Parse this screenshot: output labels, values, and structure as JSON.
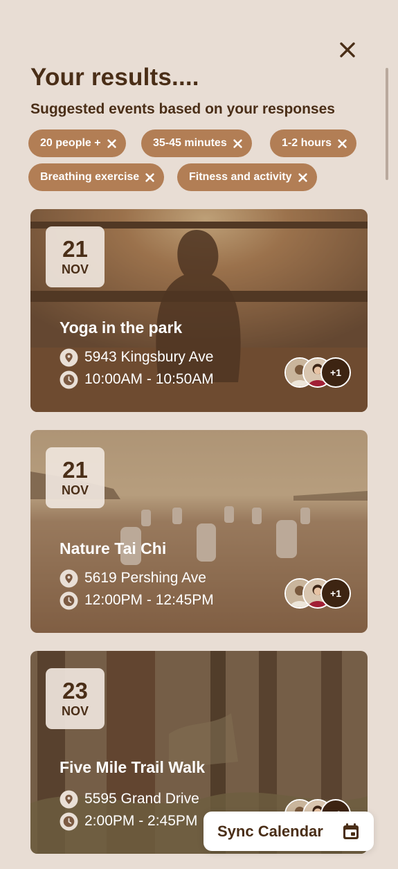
{
  "header": {
    "title": "Your results....",
    "subtitle": "Suggested events based on your responses"
  },
  "filters": [
    {
      "label": "20 people +"
    },
    {
      "label": "35-45 minutes"
    },
    {
      "label": "1-2 hours"
    },
    {
      "label": "Breathing exercise"
    },
    {
      "label": "Fitness and activity"
    }
  ],
  "events": [
    {
      "day": "21",
      "month": "NOV",
      "title": "Yoga in the park",
      "address": "5943 Kingsbury Ave",
      "time": "10:00AM - 10:50AM",
      "more": "+1"
    },
    {
      "day": "21",
      "month": "NOV",
      "title": "Nature Tai Chi",
      "address": "5619 Pershing Ave",
      "time": "12:00PM - 12:45PM",
      "more": "+1"
    },
    {
      "day": "23",
      "month": "NOV",
      "title": "Five Mile Trail Walk",
      "address": "5595 Grand Drive",
      "time": "2:00PM - 2:45PM",
      "more": "+1"
    }
  ],
  "sync": {
    "label": "Sync Calendar"
  },
  "colors": {
    "background": "#e8ddd4",
    "chip": "#b27e55",
    "text": "#4a2e17",
    "more_badge": "#3d2412"
  },
  "icons": [
    "close-icon",
    "remove-filter-icon",
    "location-pin-icon",
    "clock-icon",
    "calendar-icon"
  ]
}
